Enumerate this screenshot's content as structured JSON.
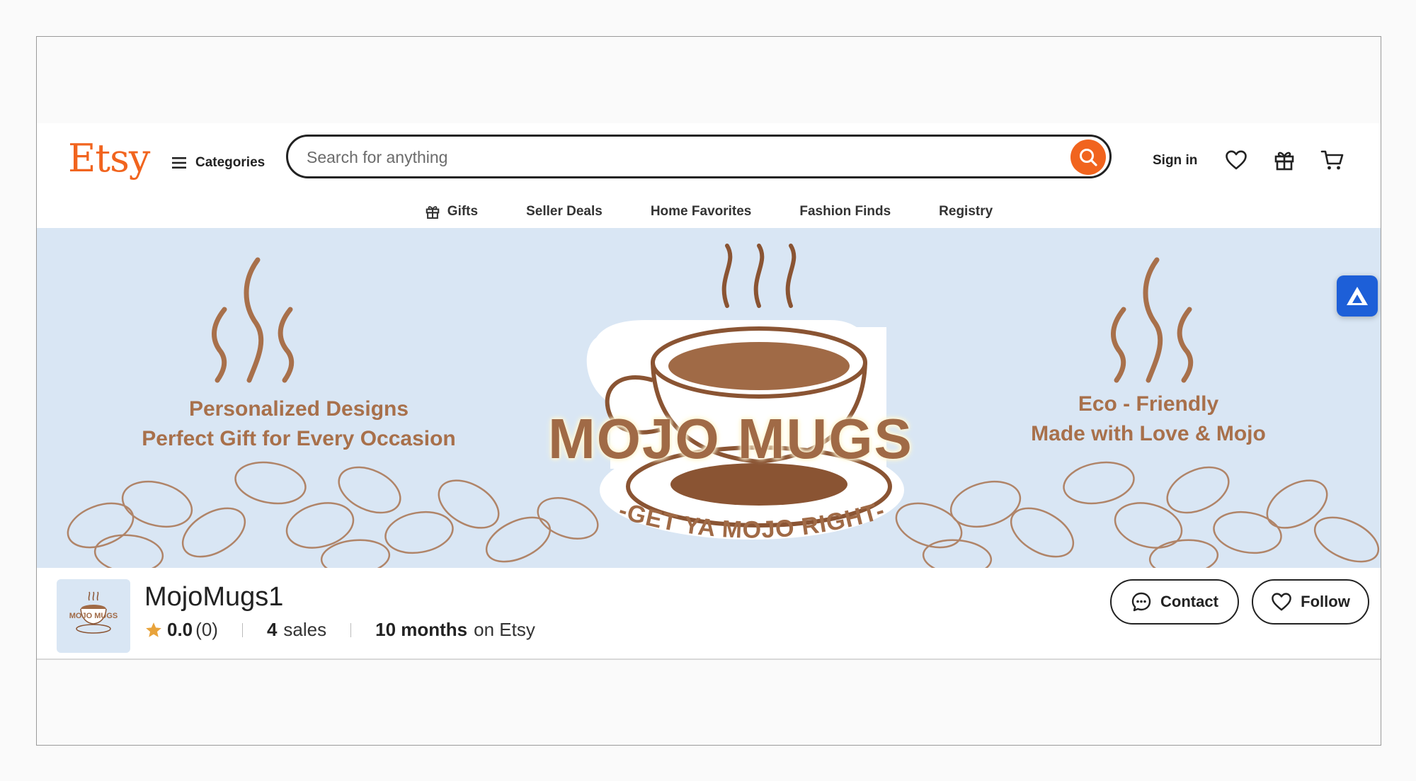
{
  "header": {
    "logo": "Etsy",
    "categories_label": "Categories",
    "search_placeholder": "Search for anything",
    "sign_in": "Sign in",
    "nav": [
      {
        "label": "Gifts",
        "icon": "gift-icon"
      },
      {
        "label": "Seller Deals"
      },
      {
        "label": "Home Favorites"
      },
      {
        "label": "Fashion Finds"
      },
      {
        "label": "Registry"
      }
    ],
    "icons": [
      "heart-icon",
      "gift-icon",
      "cart-icon"
    ]
  },
  "banner": {
    "left_line1": "Personalized Designs",
    "left_line2": "Perfect Gift for Every Occasion",
    "brand": "MOJO MUGS",
    "tagline": "-GET YA MOJO RIGHT-",
    "right_line1": "Eco - Friendly",
    "right_line2": "Made with Love & Mojo"
  },
  "shop": {
    "name": "MojoMugs1",
    "rating": "0.0",
    "review_count": "(0)",
    "sales_count": "4",
    "sales_label": "sales",
    "duration": "10 months",
    "duration_suffix": "on Etsy",
    "contact_label": "Contact",
    "follow_label": "Follow"
  },
  "colors": {
    "brand_orange": "#f1641e",
    "banner_bg": "#d9e6f4",
    "banner_text": "#a8704b",
    "star": "#e8a33b",
    "extension_blue": "#1d5fd8"
  }
}
